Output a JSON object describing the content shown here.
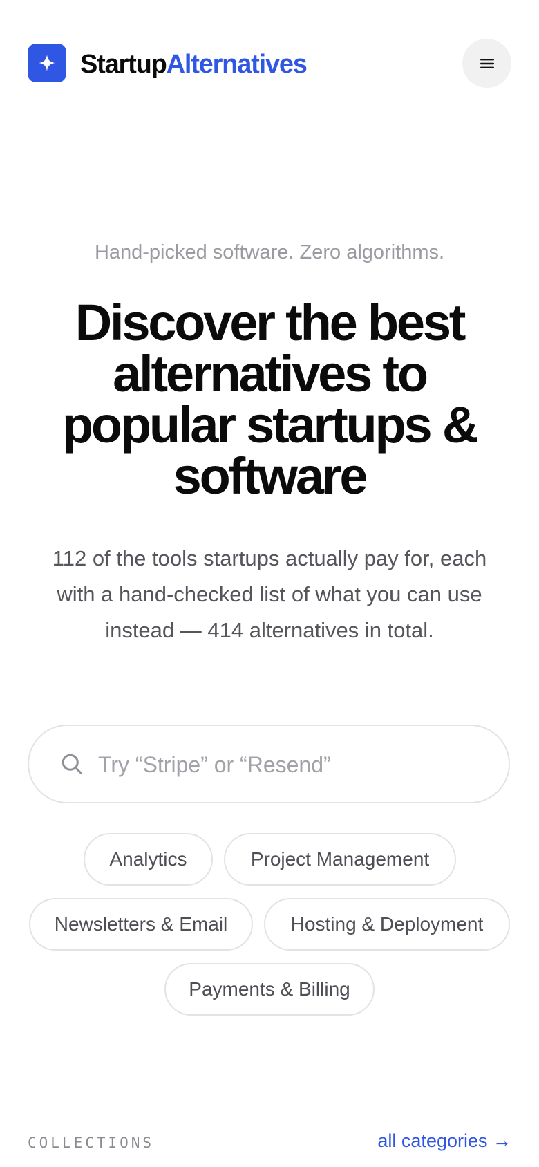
{
  "header": {
    "brand_part1": "Startup",
    "brand_part2": "Alternatives",
    "logo_icon": "sparkle-icon",
    "menu_icon": "hamburger-menu-icon"
  },
  "hero": {
    "kicker": "Hand-picked software. Zero algorithms.",
    "title": "Discover the best alternatives to popular startups & software",
    "subtitle": "112 of the tools startups actually pay for, each with a hand-checked list of what you can use instead — 414 alternatives in total."
  },
  "search": {
    "placeholder": "Try “Stripe” or “Resend”",
    "value": "",
    "icon": "search-icon"
  },
  "categories": [
    "Analytics",
    "Project Management",
    "Newsletters & Email",
    "Hosting & Deployment",
    "Payments & Billing"
  ],
  "collections": {
    "label": "COLLECTIONS",
    "link": "all categories →"
  },
  "colors": {
    "accent": "#2f57e3",
    "text": "#0b0b0c",
    "muted": "#9a9aa1",
    "border": "#e3e3e5"
  }
}
